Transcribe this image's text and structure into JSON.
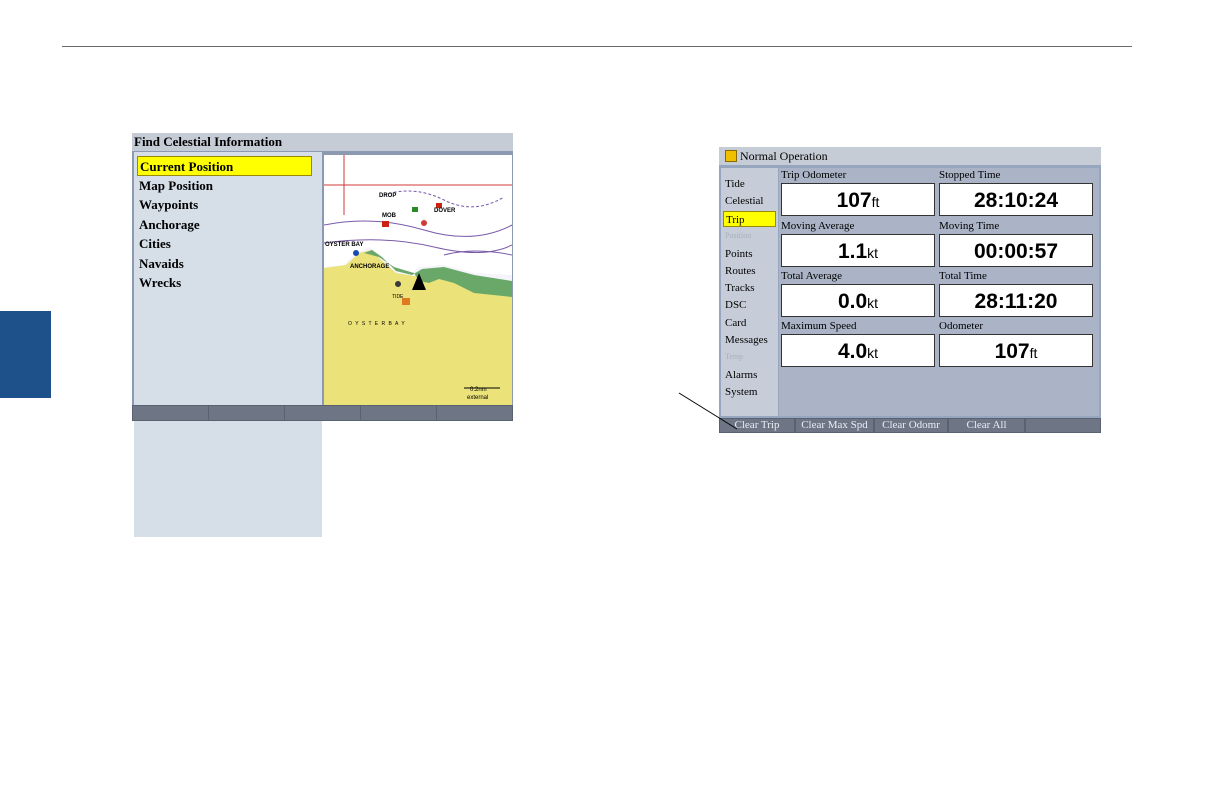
{
  "left_screen": {
    "title": "Find Celestial Information",
    "menu_items": [
      "Current Position",
      "Map Position",
      "Waypoints",
      "Anchorage",
      "Cities",
      "Navaids",
      "Wrecks"
    ],
    "selected_index": 0,
    "map": {
      "labels": [
        "DROP",
        "MOB",
        "DOVER",
        "OYSTER BAY",
        "ANCHORAGE",
        "TIDE",
        "O Y S T E R B A Y"
      ],
      "scale_value": "0.2nm",
      "scale_note": "external"
    },
    "softkeys_count": 5
  },
  "right_screen": {
    "title": "Normal Operation",
    "tabs": [
      "Tide",
      "Celestial",
      "Trip",
      "Position",
      "Points",
      "Routes",
      "Tracks",
      "DSC",
      "Card",
      "Messages",
      "Temp",
      "Alarms",
      "System"
    ],
    "selected_tab": "Trip",
    "dim_tabs": [
      "Position",
      "Temp"
    ],
    "fields": [
      {
        "label": "Trip Odometer",
        "value": "107",
        "unit": "ft"
      },
      {
        "label": "Stopped Time",
        "value": "28:10:24",
        "unit": ""
      },
      {
        "label": "Moving Average",
        "value": "1.1",
        "unit": "kt"
      },
      {
        "label": "Moving Time",
        "value": "00:00:57",
        "unit": ""
      },
      {
        "label": "Total Average",
        "value": "0.0",
        "unit": "kt"
      },
      {
        "label": "Total Time",
        "value": "28:11:20",
        "unit": ""
      },
      {
        "label": "Maximum Speed",
        "value": "4.0",
        "unit": "kt"
      },
      {
        "label": "Odometer",
        "value": "107",
        "unit": "ft"
      }
    ],
    "softkeys": [
      "Clear Trip",
      "Clear Max Spd",
      "Clear Odomr",
      "Clear All"
    ]
  },
  "colors": {
    "highlight": "#ffff00",
    "side_tab": "#1e5189",
    "softkey_bar": "#5a6170"
  }
}
